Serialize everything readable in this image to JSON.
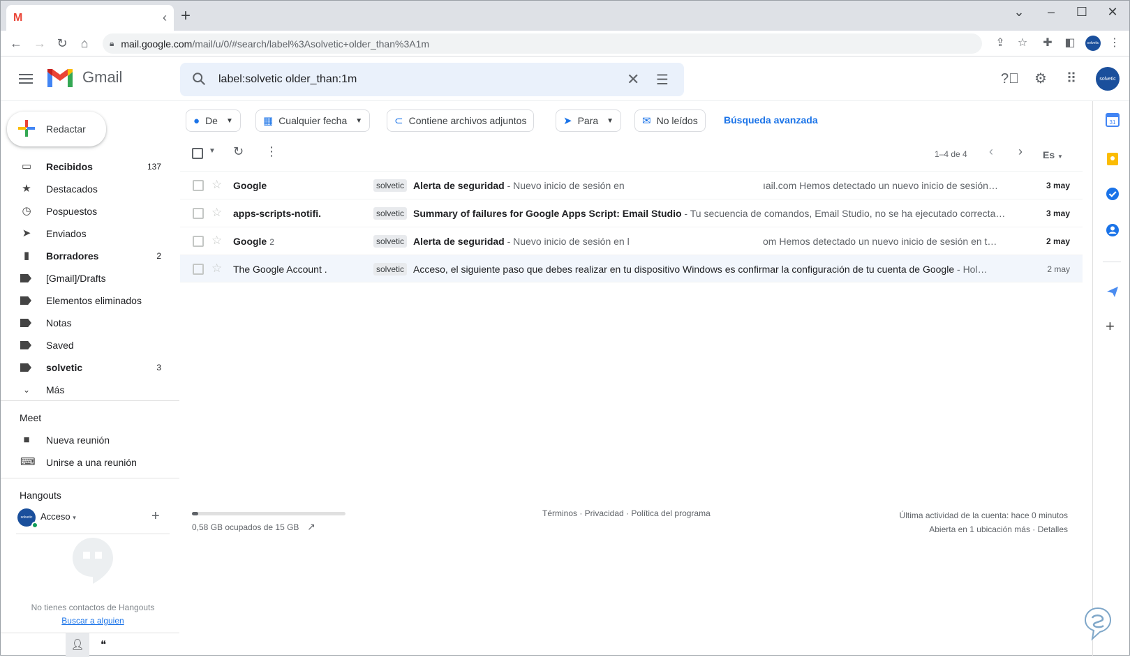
{
  "browser": {
    "tab_title": "",
    "url_host": "mail.google.com",
    "url_path": "/mail/u/0/#search/label%3Asolvetic+older_than%3A1m"
  },
  "header": {
    "product": "Gmail",
    "search_query": "label:solvetic older_than:1m",
    "avatar_text": "solvetic"
  },
  "sidebar": {
    "compose_label": "Redactar",
    "items": [
      {
        "label": "Recibidos",
        "count": "137",
        "bold": true,
        "icon": "inbox-icon"
      },
      {
        "label": "Destacados",
        "count": "",
        "bold": false,
        "icon": "star-icon"
      },
      {
        "label": "Pospuestos",
        "count": "",
        "bold": false,
        "icon": "clock-icon"
      },
      {
        "label": "Enviados",
        "count": "",
        "bold": false,
        "icon": "send-icon"
      },
      {
        "label": "Borradores",
        "count": "2",
        "bold": true,
        "icon": "draft-icon"
      },
      {
        "label": "[Gmail]/Drafts",
        "count": "",
        "bold": false,
        "icon": "label-icon"
      },
      {
        "label": "Elementos eliminados",
        "count": "",
        "bold": false,
        "icon": "label-icon"
      },
      {
        "label": "Notas",
        "count": "",
        "bold": false,
        "icon": "label-icon"
      },
      {
        "label": "Saved",
        "count": "",
        "bold": false,
        "icon": "label-icon"
      },
      {
        "label": "solvetic",
        "count": "3",
        "bold": true,
        "icon": "label-icon"
      },
      {
        "label": "Más",
        "count": "",
        "bold": false,
        "icon": "chevron-down-icon"
      }
    ],
    "meet_title": "Meet",
    "meet_items": [
      {
        "label": "Nueva reunión",
        "icon": "video-icon"
      },
      {
        "label": "Unirse a una reunión",
        "icon": "keyboard-icon"
      }
    ],
    "hangouts_title": "Hangouts",
    "hangouts_user": "Acceso",
    "no_contacts": "No tienes contactos de Hangouts",
    "find_someone": "Buscar a alguien"
  },
  "filters": {
    "chips": [
      {
        "label": "De",
        "icon": "person-icon",
        "caret": true
      },
      {
        "label": "Cualquier fecha",
        "icon": "calendar-icon",
        "caret": true
      },
      {
        "label": "Contiene archivos adjuntos",
        "icon": "attachment-icon",
        "caret": false
      },
      {
        "label": "Para",
        "icon": "send-icon",
        "caret": true
      },
      {
        "label": "No leídos",
        "icon": "mail-icon",
        "caret": false
      }
    ],
    "advanced": "Búsqueda avanzada"
  },
  "list": {
    "pager": "1–4 de 4",
    "lang": "Es",
    "emails": [
      {
        "sender": "Google",
        "count": "",
        "label": "solvetic",
        "subject": "Alerta de seguridad",
        "snippet": " - Nuevo inicio de sesión en",
        "tail": "ıail.com Hemos detectado un nuevo inicio de sesión…",
        "date": "3 may",
        "unread": true
      },
      {
        "sender": "apps-scripts-notifi.",
        "count": "",
        "label": "solvetic",
        "subject": "Summary of failures for Google Apps Script: Email Studio",
        "snippet": " - Tu secuencia de comandos, Email Studio, no se ha ejecutado correcta…",
        "tail": "",
        "date": "3 may",
        "unread": true
      },
      {
        "sender": "Google",
        "count": "2",
        "label": "solvetic",
        "subject": "Alerta de seguridad",
        "snippet": " - Nuevo inicio de sesión en l",
        "tail": "om Hemos detectado un nuevo inicio de sesión en t…",
        "date": "2 may",
        "unread": true
      },
      {
        "sender": "The Google Account .",
        "count": "",
        "label": "solvetic",
        "subject": "Acceso, el siguiente paso que debes realizar en tu dispositivo Windows es confirmar la configuración de tu cuenta de Google",
        "snippet": " - Hol…",
        "tail": "",
        "date": "2 may",
        "unread": false
      }
    ]
  },
  "footer": {
    "storage_fraction": 0.039,
    "storage_text": "0,58 GB ocupados de 15 GB",
    "links": "Términos · Privacidad · Política del programa",
    "activity_line1": "Última actividad de la cuenta: hace 0 minutos",
    "activity_line2": "Abierta en 1 ubicación más · Detalles"
  },
  "colors": {
    "accent_blue": "#1a73e8",
    "gmail_red": "#ea4335",
    "search_bg": "#eaf1fb",
    "read_row_bg": "#f2f6fc"
  }
}
